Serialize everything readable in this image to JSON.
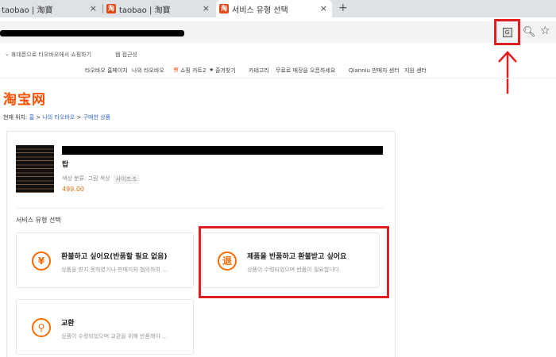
{
  "browser": {
    "tabs": [
      {
        "label": "taobao | 淘寶"
      },
      {
        "label": "taobao | 淘寶"
      },
      {
        "label": "서비스 유형 선택"
      }
    ],
    "new_tab": "+",
    "close_glyph": "×"
  },
  "shortcuts": {
    "items": [
      "휴대폰으로 타오바오에서 쇼핑하기",
      "웹 접근성"
    ]
  },
  "site_nav": {
    "items": [
      "타오바오 홈페이지",
      "나의 타오바오",
      "쇼핑 카트2",
      "즐겨찾기",
      "카테고리",
      "무료로 매장을 오픈하세요",
      "Qianniu 판매자 센터",
      "지원 센터"
    ]
  },
  "logo": "淘宝网",
  "breadcrumb": {
    "prefix": "현재 위치:",
    "items": [
      "홈",
      "나의 타오바오",
      "구매한 상품"
    ],
    "sep": ">"
  },
  "product": {
    "name": "탑",
    "attr_label": "색상 분류: 그림 색상",
    "attr_size": "사이즈:S",
    "price": "499.00"
  },
  "section_title": "서비스 유형 선택",
  "cards": [
    {
      "icon_text": "¥",
      "title": "환불하고 싶어요(반품할 필요 없음)",
      "desc": "상품을 받지 못하였거나 판매자와 협의하여 ..."
    },
    {
      "icon_text": "退",
      "title": "제품을 반품하고 환불받고 싶어요",
      "desc": "상품이 수령되었으며 반품이 필요합니다."
    },
    {
      "icon_text": "⚲",
      "title": "교환",
      "desc": "상품이 수령되었으며 교환을 위해 반품해야 ..."
    }
  ],
  "colors": {
    "accent": "#ff5000",
    "annotation": "#e02020"
  }
}
